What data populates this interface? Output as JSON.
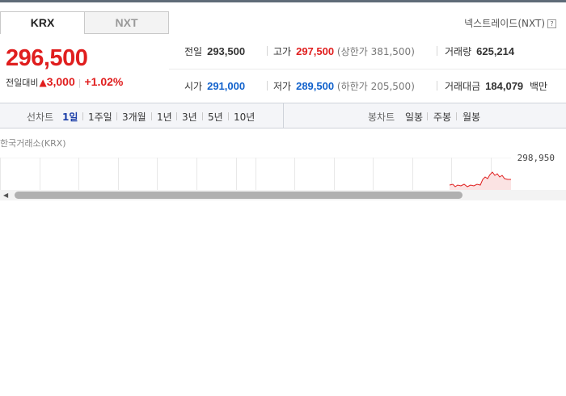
{
  "tabs": [
    {
      "label": "KRX",
      "active": true
    },
    {
      "label": "NXT",
      "active": false
    }
  ],
  "nxt_link": {
    "label": "넥스트레이드(NXT)",
    "help_icon": "?"
  },
  "price": {
    "current": "296,500",
    "diff_label": "전일대비",
    "diff_icon": "up-triangle-icon",
    "diff_value": "3,000",
    "diff_pct": "+1.02%"
  },
  "stats": {
    "prev_close": {
      "label": "전일",
      "value": "293,500"
    },
    "high": {
      "label": "고가",
      "value": "297,500",
      "sub_label": "상한가",
      "sub_value": "381,500"
    },
    "volume": {
      "label": "거래량",
      "value": "625,214"
    },
    "open": {
      "label": "시가",
      "value": "291,000"
    },
    "low": {
      "label": "저가",
      "value": "289,500",
      "sub_label": "하한가",
      "sub_value": "205,500"
    },
    "amount": {
      "label": "거래대금",
      "value": "184,079",
      "unit": "백만"
    }
  },
  "period_bar": {
    "line_chart_label": "선차트",
    "line_periods": [
      "1일",
      "1주일",
      "3개월",
      "1년",
      "3년",
      "5년",
      "10년"
    ],
    "active_period": "1일",
    "candle_chart_label": "봉차트",
    "candle_periods": [
      "일봉",
      "주봉",
      "월봉"
    ]
  },
  "chart": {
    "title": "한국거래소(KRX)",
    "y_max_label": "298,950"
  },
  "colors": {
    "up": "#e01e1e",
    "down": "#1262cc",
    "active_period": "#1c3fa8"
  }
}
